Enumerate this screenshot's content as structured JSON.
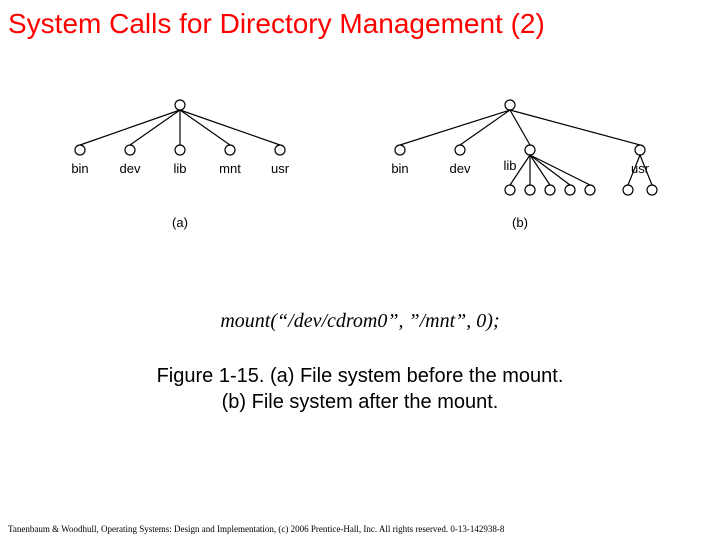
{
  "title": "System Calls for Directory Management (2)",
  "tree_a": {
    "labels": [
      "bin",
      "dev",
      "lib",
      "mnt",
      "usr"
    ],
    "sub": "(a)"
  },
  "tree_b": {
    "labels": [
      "bin",
      "dev",
      "lib",
      "usr"
    ],
    "sub": "(b)"
  },
  "code": "mount(“/dev/cdrom0”, ”/mnt”, 0);",
  "caption_line1": "Figure 1-15. (a) File system before the mount.",
  "caption_line2": "(b) File system after the mount.",
  "footer": "Tanenbaum & Woodhull, Operating Systems: Design and Implementation, (c) 2006 Prentice-Hall, Inc. All rights reserved. 0-13-142938-8"
}
